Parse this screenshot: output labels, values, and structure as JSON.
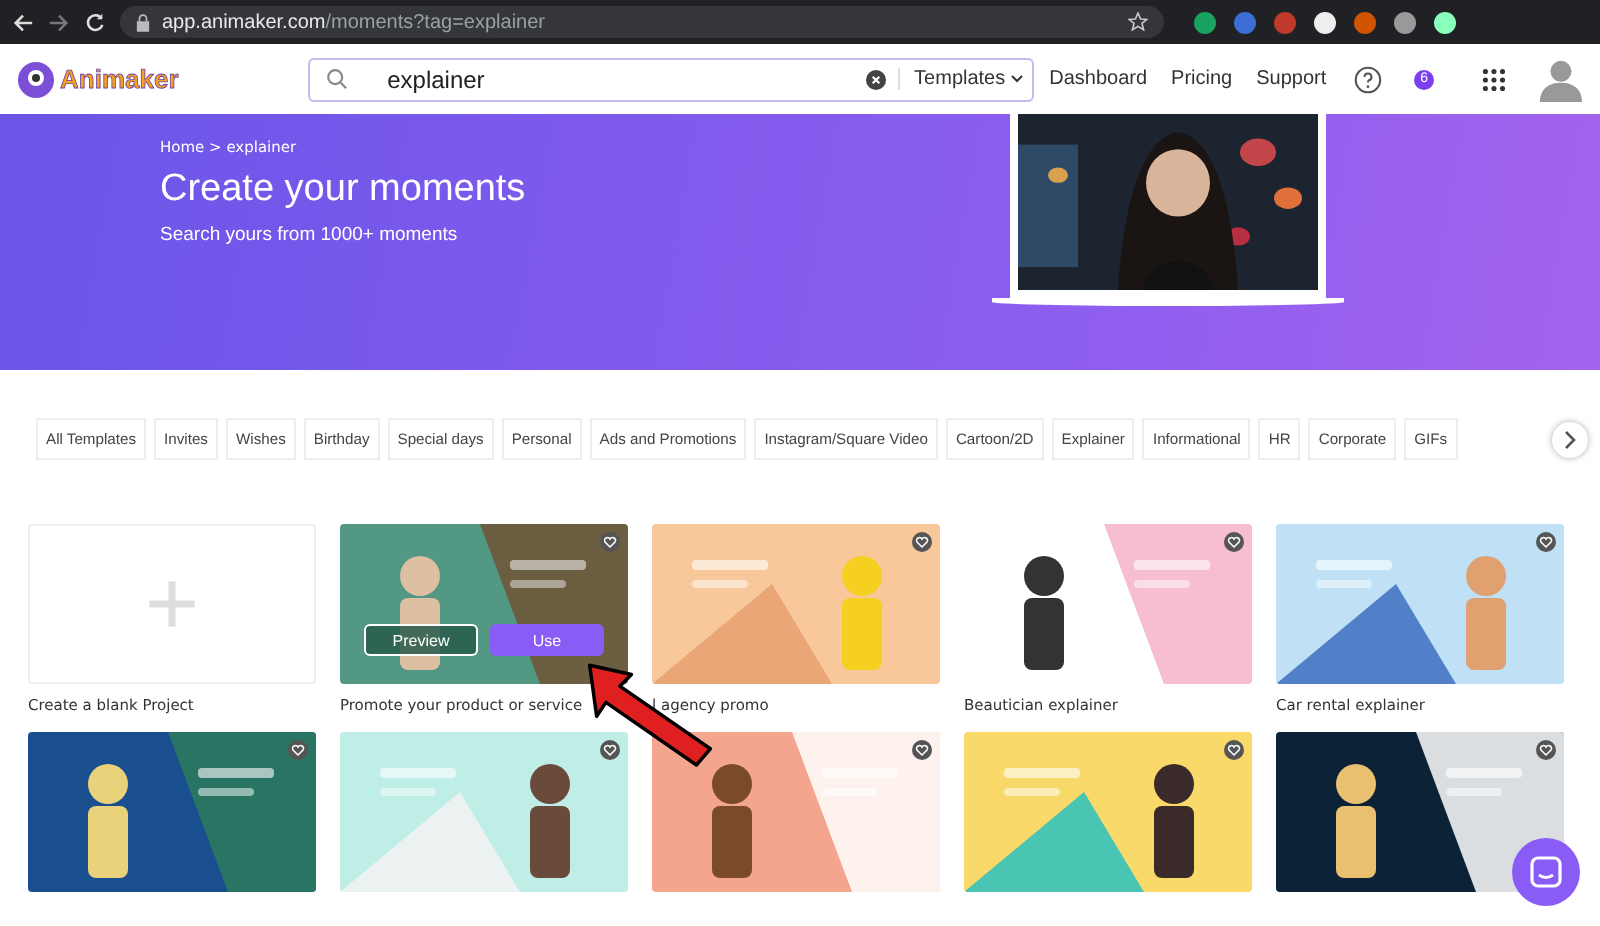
{
  "browser": {
    "url_host": "app.animaker.com",
    "url_path": "/moments?tag=explainer"
  },
  "header": {
    "logo": "Animaker",
    "search": {
      "value": "explainer"
    },
    "search_scope": "Templates",
    "nav": [
      "Dashboard",
      "Pricing",
      "Support"
    ],
    "notification_count": "6"
  },
  "hero": {
    "breadcrumb": "Home > explainer",
    "title": "Create your moments",
    "subtitle": "Search yours from 1000+ moments"
  },
  "categories": [
    {
      "label": "All Templates"
    },
    {
      "label": "Invites"
    },
    {
      "label": "Wishes"
    },
    {
      "label": "Birthday"
    },
    {
      "label": "Special days"
    },
    {
      "label": "Personal"
    },
    {
      "label": "Ads and Promotions"
    },
    {
      "label": "Instagram/Square Video"
    },
    {
      "label": "Cartoon/2D"
    },
    {
      "label": "Explainer"
    },
    {
      "label": "Informational"
    },
    {
      "label": "HR"
    },
    {
      "label": "Corporate"
    },
    {
      "label": "GIFs"
    }
  ],
  "templates": [
    {
      "kind": "blank",
      "title": "Create a blank Project"
    },
    {
      "kind": "template",
      "title": "Promote your product or service",
      "hovered": true,
      "actions": [
        "Preview",
        "Use"
      ]
    },
    {
      "kind": "template",
      "title": "l agency promo",
      "hovered": false
    },
    {
      "kind": "template",
      "title": "Beautician explainer",
      "hovered": false
    },
    {
      "kind": "template",
      "title": "Car rental explainer",
      "hovered": false
    },
    {
      "kind": "template",
      "hovered": false
    },
    {
      "kind": "template",
      "hovered": false
    },
    {
      "kind": "template",
      "hovered": false
    },
    {
      "kind": "template",
      "hovered": false
    },
    {
      "kind": "template",
      "hovered": false
    }
  ]
}
